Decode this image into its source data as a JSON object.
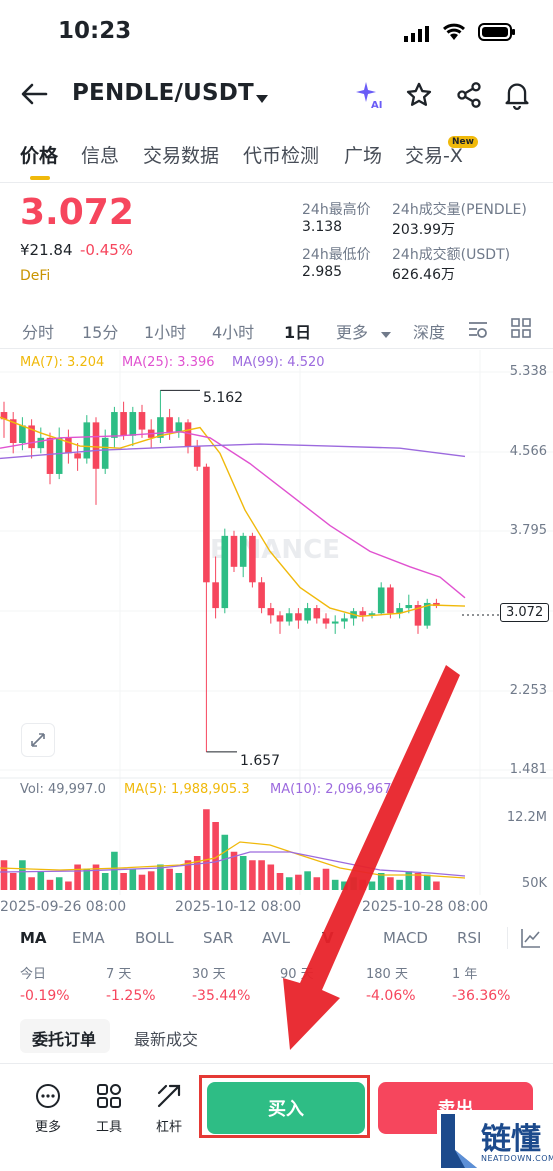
{
  "status": {
    "time": "10:23"
  },
  "nav": {
    "title": "PENDLE/USDT"
  },
  "tabs": [
    {
      "label": "价格"
    },
    {
      "label": "信息"
    },
    {
      "label": "交易数据"
    },
    {
      "label": "代币检测"
    },
    {
      "label": "广场"
    },
    {
      "label": "交易-X"
    }
  ],
  "tab_badge": "New",
  "ticker": {
    "price": "3.072",
    "cny": "¥21.84",
    "change": "-0.45%",
    "tag": "DeFi",
    "high_label": "24h最高价",
    "high": "3.138",
    "low_label": "24h最低价",
    "low": "2.985",
    "vol_label": "24h成交量(PENDLE)",
    "vol": "203.99万",
    "amt_label": "24h成交额(USDT)",
    "amt": "626.46万"
  },
  "intervals": [
    "分时",
    "15分",
    "1小时",
    "4小时",
    "1日",
    "更多",
    "深度"
  ],
  "active_interval": "1日",
  "ma_legend": {
    "ma7": "MA(7): 3.204",
    "ma25": "MA(25): 3.396",
    "ma99": "MA(99): 4.520"
  },
  "price_axis": [
    "5.338",
    "4.566",
    "3.795",
    "3.072",
    "2.253",
    "1.481"
  ],
  "annotations": {
    "high": "5.162",
    "low": "1.657"
  },
  "watermark": "BINANCE",
  "volume_legend": {
    "vol": "Vol: 49,997.0",
    "ma5": "MA(5): 1,988,905.3",
    "ma10": "MA(10): 2,096,967"
  },
  "volume_axis": [
    "12.2M",
    "50K"
  ],
  "date_axis": [
    "2025-09-26 08:00",
    "2025-10-12 08:00",
    "2025-10-28 08:00"
  ],
  "indicators": [
    "MA",
    "EMA",
    "BOLL",
    "SAR",
    "AVL",
    "V",
    "MACD",
    "RSI"
  ],
  "performance": [
    {
      "label": "今日",
      "value": "-0.19%"
    },
    {
      "label": "7 天",
      "value": "-1.25%"
    },
    {
      "label": "30 天",
      "value": "-35.44%"
    },
    {
      "label": "90 天",
      "value": ""
    },
    {
      "label": "180 天",
      "value": "-4.06%"
    },
    {
      "label": "1 年",
      "value": "-36.36%"
    }
  ],
  "order_tabs": {
    "orders": "委托订单",
    "trades": "最新成交"
  },
  "bottom": {
    "more": "更多",
    "tools": "工具",
    "leverage": "杠杆",
    "buy": "买入",
    "sell": "卖出"
  },
  "overlay_logo": {
    "cn": "链懂",
    "en": "NEATDOWN.COM"
  },
  "colors": {
    "up": "#2ebd85",
    "down": "#f6465d",
    "accent": "#f0b90b",
    "ma7": "#f0b90b",
    "ma25": "#e052d0",
    "ma99": "#9c6ade"
  }
}
